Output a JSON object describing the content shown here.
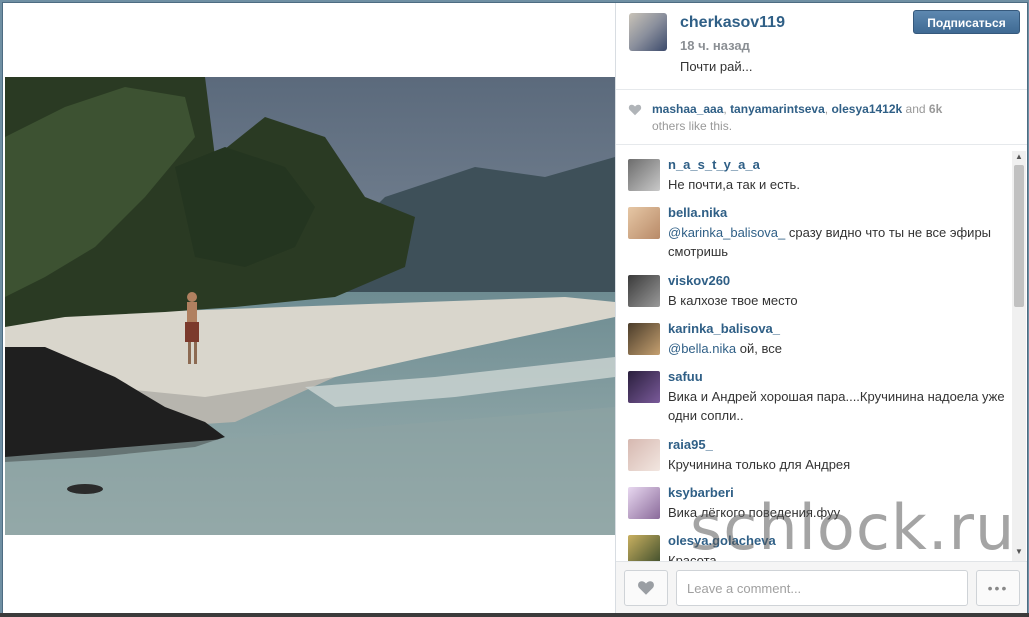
{
  "post": {
    "username": "cherkasov119",
    "time_ago": "18 ч. назад",
    "caption": "Почти рай...",
    "follow_label": "Подписаться"
  },
  "likes": {
    "users": [
      "mashaa_aaa",
      "tanyamarintseva",
      "olesya1412k"
    ],
    "and_word": "and",
    "count": "6k",
    "suffix": "others like this.",
    "sep": ", "
  },
  "comments": [
    {
      "user": "n_a_s_t_y_a_a",
      "text": "Не почти,а так и есть."
    },
    {
      "user": "bella.nika",
      "mention": "@karinka_balisova_",
      "text": " сразу видно что ты не все эфиры смотришь"
    },
    {
      "user": "viskov260",
      "text": "В калхозе твое место"
    },
    {
      "user": "karinka_balisova_",
      "mention": "@bella.nika",
      "text": " ой, все"
    },
    {
      "user": "safuu",
      "text": "Вика и Андрей хорошая пара....Кручинина надоела уже одни сопли.."
    },
    {
      "user": "raia95_",
      "text": "Кручинина только для Андрея"
    },
    {
      "user": "ksybarberi",
      "text": "Вика лёгкого поведения.фуу"
    },
    {
      "user": "olesya.golacheva",
      "text": "Красота"
    }
  ],
  "footer": {
    "comment_placeholder": "Leave a comment...",
    "more_label": "•••"
  },
  "watermark": "schlock.ru",
  "colors": {
    "link": "#2f5f86",
    "follow_button": "#4a76a0"
  },
  "icons": {
    "heart": "heart-icon",
    "more": "more-options-icon",
    "scroll_up": "scroll-up-icon",
    "scroll_down": "scroll-down-icon"
  }
}
